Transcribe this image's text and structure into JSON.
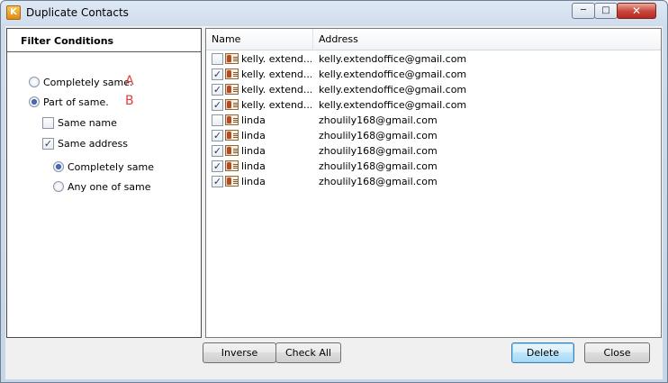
{
  "window": {
    "title": "Duplicate Contacts",
    "app_icon_letter": "K"
  },
  "caption": {
    "minimize": "─",
    "maximize": "□",
    "close": "✕"
  },
  "filter": {
    "header": "Filter Conditions",
    "completely_same": {
      "label": "Completely same.",
      "marker": "A",
      "checked": false
    },
    "part_of_same": {
      "label": "Part of same.",
      "marker": "B",
      "checked": true
    },
    "same_name": {
      "label": "Same name",
      "checked": false
    },
    "same_address": {
      "label": "Same address",
      "checked": true
    },
    "sub_completely_same": {
      "label": "Completely same",
      "checked": true
    },
    "sub_any_one": {
      "label": "Any one of same",
      "checked": false
    }
  },
  "list": {
    "columns": {
      "name": "Name",
      "address": "Address"
    },
    "rows": [
      {
        "checked": false,
        "name": "kelly. extend...",
        "address": "kelly.extendoffice@gmail.com"
      },
      {
        "checked": true,
        "name": "kelly. extend...",
        "address": "kelly.extendoffice@gmail.com"
      },
      {
        "checked": true,
        "name": "kelly. extend...",
        "address": "kelly.extendoffice@gmail.com"
      },
      {
        "checked": true,
        "name": "kelly. extend...",
        "address": "kelly.extendoffice@gmail.com"
      },
      {
        "checked": false,
        "name": "linda",
        "address": "zhoulily168@gmail.com"
      },
      {
        "checked": true,
        "name": "linda",
        "address": "zhoulily168@gmail.com"
      },
      {
        "checked": true,
        "name": "linda",
        "address": "zhoulily168@gmail.com"
      },
      {
        "checked": true,
        "name": "linda",
        "address": "zhoulily168@gmail.com"
      },
      {
        "checked": true,
        "name": "linda",
        "address": "zhoulily168@gmail.com"
      }
    ]
  },
  "buttons": {
    "inverse": "Inverse",
    "check_all": "Check All",
    "delete": "Delete",
    "close": "Close"
  },
  "icons": {
    "contact": "contact-card-icon",
    "check": "check-icon"
  }
}
